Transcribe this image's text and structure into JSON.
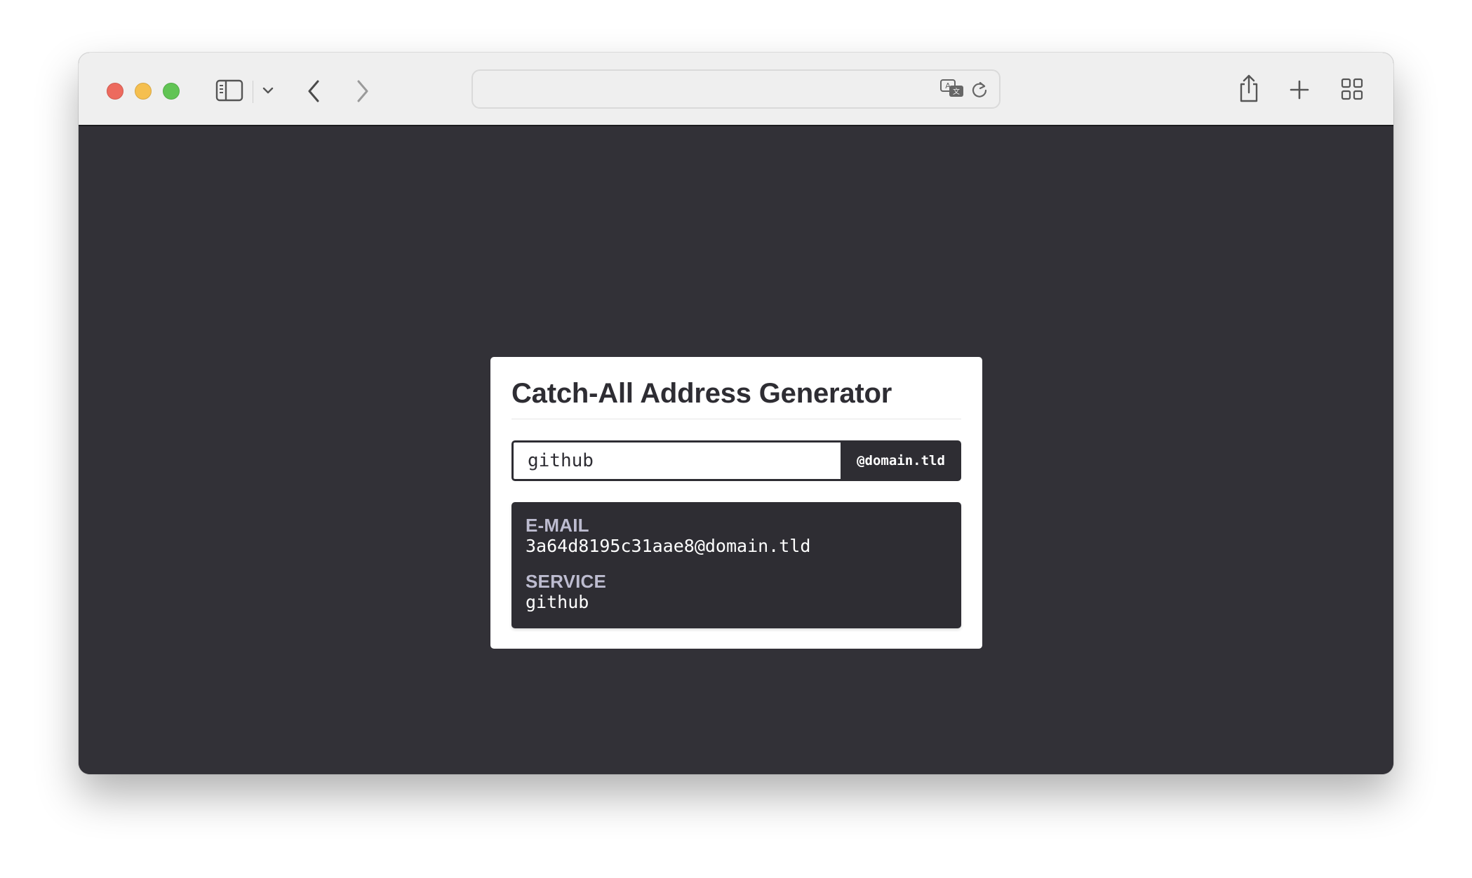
{
  "browser": {
    "url": "",
    "icons": {
      "sidebar": "sidebar-icon",
      "sidebar_menu": "chevron-down-icon",
      "back": "chevron-left-icon",
      "forward": "chevron-right-icon",
      "translate": "translate-icon",
      "reload": "reload-icon",
      "share": "share-icon",
      "new_tab": "plus-icon",
      "tab_overview": "grid-icon"
    }
  },
  "app": {
    "title": "Catch-All Address Generator",
    "service_input": {
      "value": "github",
      "placeholder": ""
    },
    "domain_suffix": "@domain.tld",
    "result": {
      "email_label": "E-MAIL",
      "email_value": "3a64d8195c31aae8@domain.tld",
      "service_label": "SERVICE",
      "service_value": "github"
    }
  },
  "colors": {
    "page_background": "#323137",
    "card_background": "#ffffff",
    "accent_dark": "#2e2d33",
    "label_muted": "#bdbcd0"
  }
}
